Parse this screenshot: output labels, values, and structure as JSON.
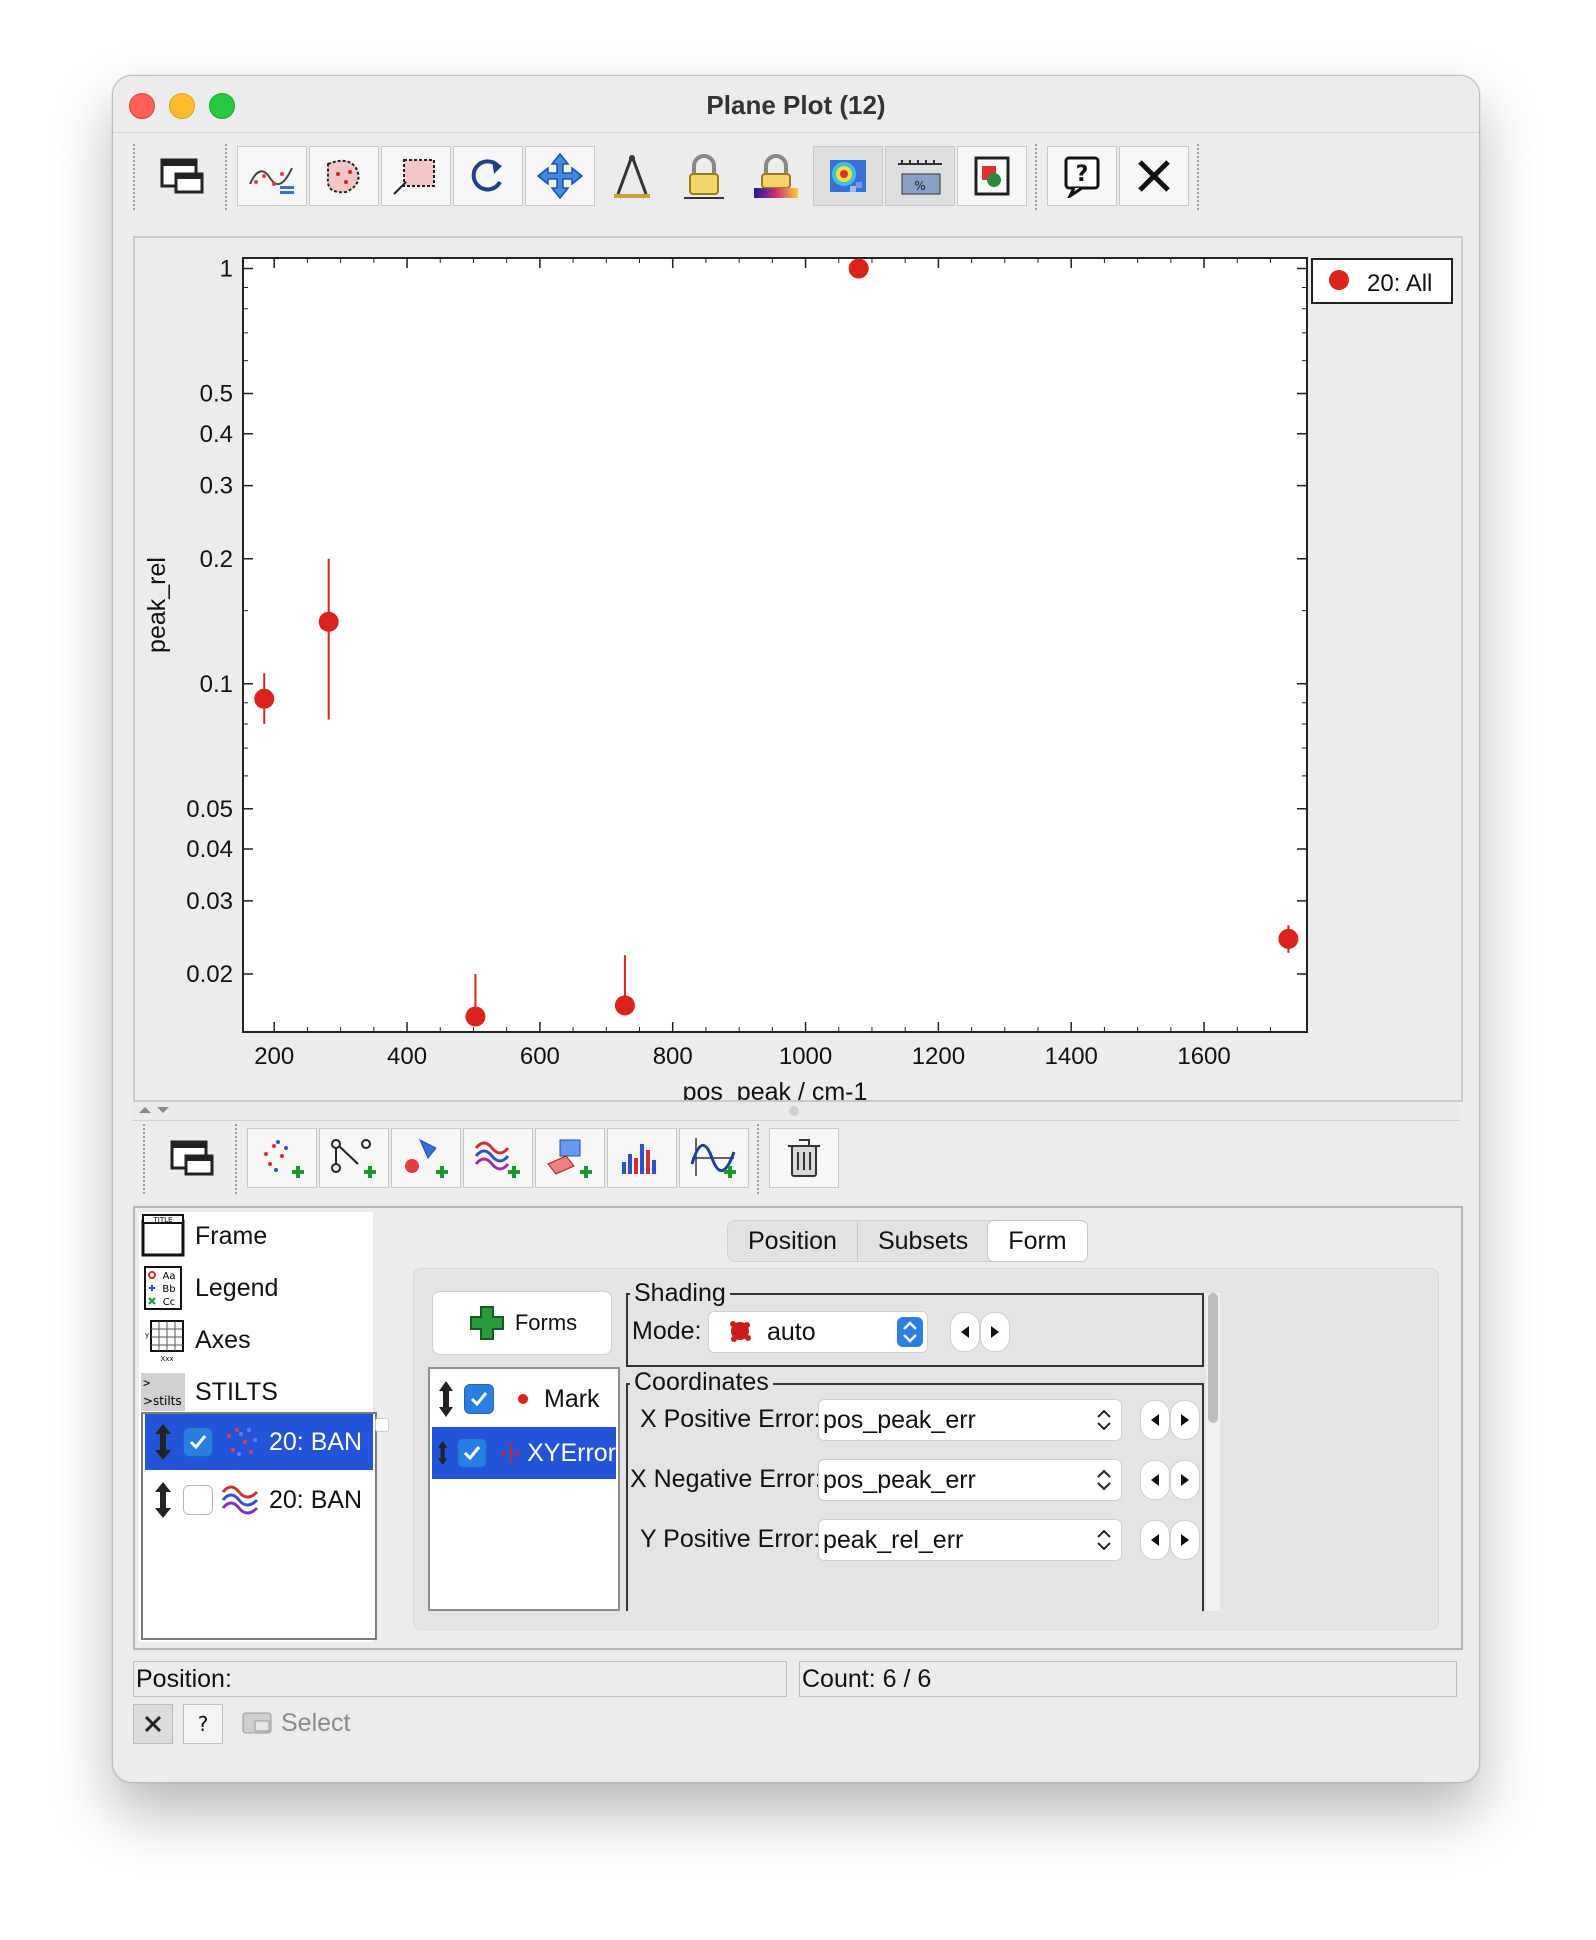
{
  "window": {
    "title": "Plane Plot (12)"
  },
  "toolbar": {
    "buttons": [
      "window-icon",
      "replot-icon",
      "subset-draw-icon",
      "subset-rect-icon",
      "reload-icon",
      "navigate-icon",
      "axes-icon",
      "axis-lock-icon",
      "aux-lock-icon",
      "heatmap-icon",
      "legend-toggle-icon",
      "export-icon",
      "help-icon",
      "close-icon"
    ]
  },
  "plot": {
    "legend_label": "20: All",
    "marker_color": "#d9231c"
  },
  "chart_data": {
    "type": "scatter",
    "xlabel": "pos_peak / cm-1",
    "ylabel": "peak_rel",
    "xlim": [
      153,
      1755
    ],
    "ylim": [
      0.0145,
      1.06
    ],
    "yscale": "log",
    "x_ticks": [
      "200",
      "400",
      "600",
      "800",
      "1000",
      "1200",
      "1400",
      "1600"
    ],
    "y_ticks": [
      "1",
      "0.5",
      "0.4",
      "0.3",
      "0.2",
      "0.1",
      "0.05",
      "0.04",
      "0.03",
      "0.02"
    ],
    "series": [
      {
        "name": "20: All",
        "points": [
          {
            "x": 185,
            "y": 0.092,
            "ylo": 0.08,
            "yhi": 0.106
          },
          {
            "x": 282,
            "y": 0.141,
            "ylo": 0.082,
            "yhi": 0.2
          },
          {
            "x": 503,
            "y": 0.0158,
            "ylo": 0.0158,
            "yhi": 0.02
          },
          {
            "x": 728,
            "y": 0.0168,
            "ylo": 0.0168,
            "yhi": 0.0222
          },
          {
            "x": 1080,
            "y": 1.0,
            "ylo": 1.0,
            "yhi": 1.0
          },
          {
            "x": 1727,
            "y": 0.0243,
            "ylo": 0.0225,
            "yhi": 0.0262
          }
        ]
      }
    ],
    "grid": false,
    "legend_position": "top-right"
  },
  "layer_toolbar": {
    "buttons": [
      "window-icon",
      "add-scatter-icon",
      "add-pair-icon",
      "add-marker-icon",
      "add-density-icon",
      "add-area-icon",
      "add-histogram-icon",
      "add-function-icon",
      "delete-icon"
    ]
  },
  "left_list": {
    "items": [
      "Frame",
      "Legend",
      "Axes",
      "STILTS"
    ]
  },
  "layers": [
    {
      "label": "20: BAN",
      "checked": true,
      "selected": true
    },
    {
      "label": "20: BAN",
      "checked": false,
      "selected": false
    }
  ],
  "tabs": [
    "Position",
    "Subsets",
    "Form"
  ],
  "active_tab": "Form",
  "forms": {
    "button": "Forms",
    "items": [
      {
        "label": "Mark",
        "checked": true,
        "selected": false
      },
      {
        "label": "XYError",
        "checked": true,
        "selected": true
      }
    ]
  },
  "shading": {
    "legend": "Shading",
    "mode_label": "Mode:",
    "mode_value": "auto"
  },
  "coordinates": {
    "legend": "Coordinates",
    "fields": [
      {
        "label": "X Positive Error:",
        "value": "pos_peak_err"
      },
      {
        "label": "X Negative Error:",
        "value": "pos_peak_err"
      },
      {
        "label": "Y Positive Error:",
        "value": "peak_rel_err"
      }
    ]
  },
  "status": {
    "position_label": "Position:",
    "count_label": "Count: 6 / 6",
    "select_label": "Select"
  }
}
